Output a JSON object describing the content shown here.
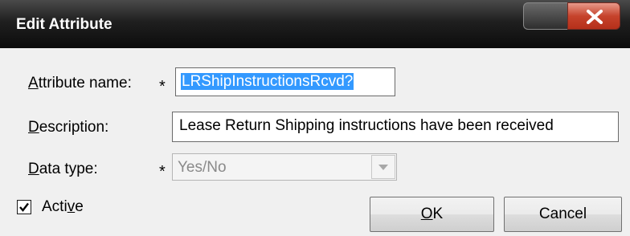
{
  "window": {
    "title": "Edit Attribute",
    "minimize_icon": "minimize-icon",
    "close_icon": "close-icon"
  },
  "form": {
    "attribute_name": {
      "label_accel": "A",
      "label_rest": "ttribute name:",
      "required": "*",
      "value": "LRShipInstructionsRcvd?",
      "selected": true
    },
    "description": {
      "label_accel": "D",
      "label_rest": "escription:",
      "value": "Lease Return Shipping instructions have been received"
    },
    "data_type": {
      "label_accel": "D",
      "label_rest": "ata type:",
      "required": "*",
      "value": "Yes/No",
      "disabled": true,
      "dropdown_icon": "chevron-down-icon"
    },
    "active": {
      "label_pre": "Acti",
      "label_accel": "v",
      "label_post": "e",
      "checked": true
    }
  },
  "buttons": {
    "ok_accel": "O",
    "ok_rest": "K",
    "cancel": "Cancel"
  },
  "colors": {
    "selection": "#3399ff",
    "close_button": "#c6432c"
  }
}
